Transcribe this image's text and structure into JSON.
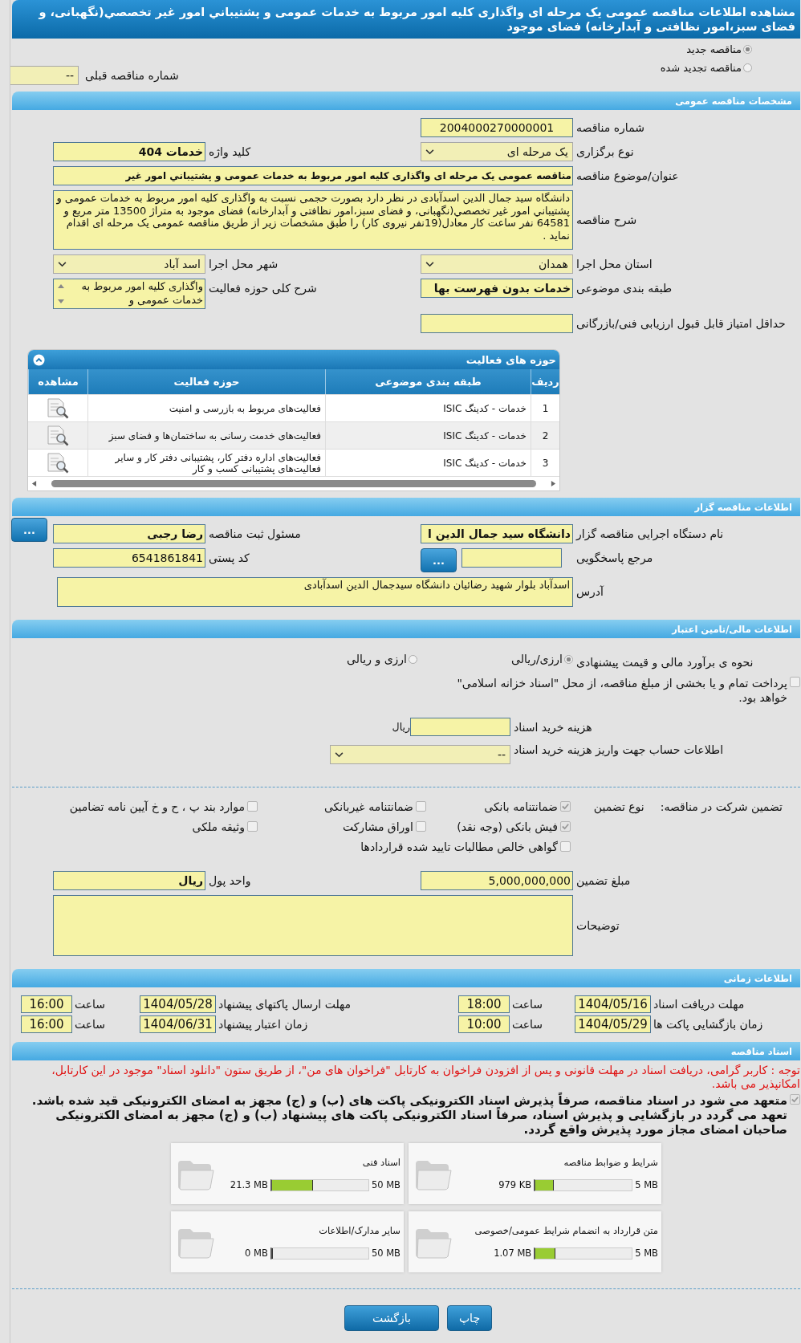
{
  "title": "مشاهده اطلاعات مناقصه عمومی یک مرحله ای واگذاری کلیه امور مربوط به خدمات عمومی و پشتيباني امور غير تخصصي(نگهبانی، و فضای سبز،امور نظافتی و آبدارخانه) فضای موجود",
  "tender_status": [
    {
      "label": "مناقصه جدید",
      "selected": true
    },
    {
      "label": "مناقصه تجدید شده",
      "selected": false
    }
  ],
  "previous_tender": {
    "label": "شماره مناقصه قبلی",
    "value": "--"
  },
  "general": {
    "header": "مشخصات مناقصه عمومی",
    "rows": [
      {
        "cells": [
          {
            "label": "شماره مناقصه",
            "value": "2004000270000001",
            "kind": "code",
            "bold": false
          }
        ]
      },
      {
        "cells": [
          {
            "label": "نوع برگزاری",
            "value": "یک مرحله ای",
            "kind": "select",
            "bold": false
          },
          {
            "label": "کلید واژه",
            "value": "خدمات 404",
            "kind": "input",
            "bold": true
          }
        ]
      },
      {
        "cells": [
          {
            "label": "عنوان/موضوع مناقصه",
            "value": "مناقصه عمومی یک مرحله ای واگذاری کلیه امور مربوط به خدمات عمومی و پشتيباني امور غير",
            "kind": "wide_input",
            "bold": true
          }
        ]
      },
      {
        "cells": [
          {
            "label": "شرح مناقصه",
            "value": "دانشگاه سید جمال الدین اسدآبادی در نظر دارد بصورت حجمی نسبت به واگذاری کلیه امور مربوط به خدمات عمومی و پشتيباني امور غير تخصصي(نگهبانی، و فضای سبز،امور نظافتی و آبدارخانه) فضای موجود به متراژ 13500  متر مربع و 64581  نفر ساعت کار معادل(19نفر نیروی کار)  را طبق مشخصات زیر از طریق مناقصه عمومی یک مرحله ای اقدام نماید .",
            "kind": "textarea",
            "bold": false
          }
        ]
      },
      {
        "cells": [
          {
            "label": "استان محل اجرا",
            "value": "همدان",
            "kind": "select",
            "bold": false
          },
          {
            "label": "شهر محل اجرا",
            "value": "اسد آباد",
            "kind": "select",
            "bold": false
          }
        ]
      },
      {
        "cells": [
          {
            "label": "طبقه بندی موضوعی",
            "value": "خدمات بدون فهرست بها",
            "kind": "input",
            "bold": true
          },
          {
            "label": "شرح کلی حوزه فعالیت",
            "value": "واگذاری کلیه امور مربوط به خدمات عمومی و",
            "kind": "listbox",
            "bold": false
          }
        ]
      },
      {
        "cells": [
          {
            "label": "حداقل امتیاز قابل قبول ارزیابی فنی/بازرگانی",
            "kind": "input"
          }
        ]
      }
    ]
  },
  "activities": {
    "header": "حوزه های فعالیت",
    "expanded": true,
    "columns": [
      "ردیف",
      "طبقه بندی موضوعی",
      "حوزه فعالیت",
      "مشاهده"
    ],
    "rows": [
      {
        "cells": [
          "1",
          "خدمات - کدینگ ISIC",
          "فعالیت‌های مربوط به بازرسی و امنیت"
        ]
      },
      {
        "cells": [
          "2",
          "خدمات - کدینگ ISIC",
          "فعالیت‌های خدمت رسانی به ساختمان‌ها و فضای سبز"
        ]
      },
      {
        "cells": [
          "3",
          "خدمات - کدینگ ISIC",
          "فعالیت‌های  اداره دفتر کار، پشتیبانی دفتر کار و سایر  فعالیت‌های پشتیبانی کسب و کار"
        ]
      }
    ]
  },
  "organizer": {
    "header": "اطلاعات مناقصه گزار",
    "rows": [
      {
        "cells": [
          {
            "label": "نام دستگاه اجرایی مناقصه گزار",
            "value": "دانشگاه سید جمال الدین ا",
            "kind": "input",
            "bold": true
          },
          {
            "label": "مسئول ثبت مناقصه",
            "value": "رضا  رجبی",
            "kind": "input",
            "bold": true,
            "button": "..."
          }
        ]
      },
      {
        "cells": [
          {
            "label": "مرجع پاسخگویی",
            "kind": "input",
            "button": "..."
          },
          {
            "label": "کد پستی",
            "value": "6541861841",
            "kind": "input",
            "bold": false
          }
        ]
      },
      {
        "cells": [
          {
            "label": "آدرس",
            "value": "اسدآباد بلوار شهید رضائیان دانشگاه سیدجمال الدین اسدآبادی",
            "kind": "address",
            "bold": false
          }
        ]
      }
    ]
  },
  "finance": {
    "header": "اطلاعات مالی/تامین اعتبار",
    "estimate": {
      "label": "نحوه ی برآورد مالی و قیمت پیشنهادی",
      "options": [
        {
          "label": "ارزی/ریالی",
          "selected": true
        },
        {
          "label": "ارزی و ریالی",
          "selected": false
        }
      ]
    },
    "treasury": {
      "label": "پرداخت تمام و یا بخشی از مبلغ مناقصه، از محل \"اسناد خزانه اسلامی\" خواهد بود.",
      "checked": false
    },
    "doc_cost": {
      "label": "هزینه خرید اسناد",
      "unit": "ریال"
    },
    "account": {
      "label": "اطلاعات حساب جهت واریز هزینه خرید اسناد",
      "value": "--"
    }
  },
  "guarantee": {
    "label": "تضمین شرکت در مناقصه:",
    "type_label": "نوع تضمین",
    "options": [
      {
        "label": "ضمانتنامه بانکی",
        "checked": true
      },
      {
        "label": "ضمانتنامه غیربانکی",
        "checked": false
      },
      {
        "label": "موارد بند پ ، ح و خ آیین نامه تضامین",
        "checked": false
      },
      {
        "label": "فیش بانکی (وجه نقد)",
        "checked": true
      },
      {
        "label": "اوراق مشارکت",
        "checked": false
      },
      {
        "label": "وثیقه ملکی",
        "checked": false
      },
      {
        "label": "گواهی خالص مطالبات تایید شده قراردادها",
        "checked": false
      }
    ],
    "amount": {
      "label": "مبلغ تضمین",
      "value": "5,000,000,000"
    },
    "currency": {
      "label": "واحد پول",
      "value": "ریال"
    },
    "notes": {
      "label": "توضیحات"
    }
  },
  "timing": {
    "header": "اطلاعات زمانی",
    "items": [
      {
        "label": "مهلت دریافت اسناد",
        "date": "1404/05/16",
        "time_label": "ساعت",
        "time": "18:00"
      },
      {
        "label": "مهلت ارسال پاکتهای پیشنهاد",
        "date": "1404/05/28",
        "time_label": "ساعت",
        "time": "16:00"
      },
      {
        "label": "زمان بازگشایی پاکت ها",
        "date": "1404/05/29",
        "time_label": "ساعت",
        "time": "10:00"
      },
      {
        "label": "زمان اعتبار پیشنهاد",
        "date": "1404/06/31",
        "time_label": "ساعت",
        "time": "16:00"
      }
    ]
  },
  "documents": {
    "header": "اسناد مناقصه",
    "notice": "توجه : کاربر گرامی، دریافت اسناد در مهلت قانونی و پس از افزودن فراخوان به کارتابل \"فراخوان های من\"، از طریق ستون \"دانلود اسناد\" موجود در این کارتابل، امکانپذیر می باشد.",
    "commitment": {
      "text": "متعهد می شود در اسناد مناقصه، صرفاً پذیرش اسناد الکترونیکی پاکت های (ب) و (ج) مجهز به امضای الکترونیکی قید شده باشد. تعهد می گردد در بازگشایی و پذیرش اسناد، صرفاً اسناد الکترونیکی پاکت های پیشنهاد (ب) و (ج) مجهز به امضای الکترونیکی صاحبان امضای مجاز مورد پذیرش واقع گردد.",
      "checked": true
    },
    "files": [
      {
        "title": "شرایط و ضوابط مناقصه",
        "used": "979 KB",
        "max": "5 MB",
        "level": 0.19
      },
      {
        "title": "اسناد فنی",
        "used": "21.3 MB",
        "max": "50 MB",
        "level": 0.43
      },
      {
        "title": "متن قرارداد به انضمام شرایط عمومی/خصوصی",
        "used": "1.07 MB",
        "max": "5 MB",
        "level": 0.21
      },
      {
        "title": "سایر مدارک/اطلاعات",
        "used": "0 MB",
        "max": "50 MB",
        "level": 0
      }
    ]
  },
  "buttons": [
    "چاپ",
    "بازگشت"
  ]
}
